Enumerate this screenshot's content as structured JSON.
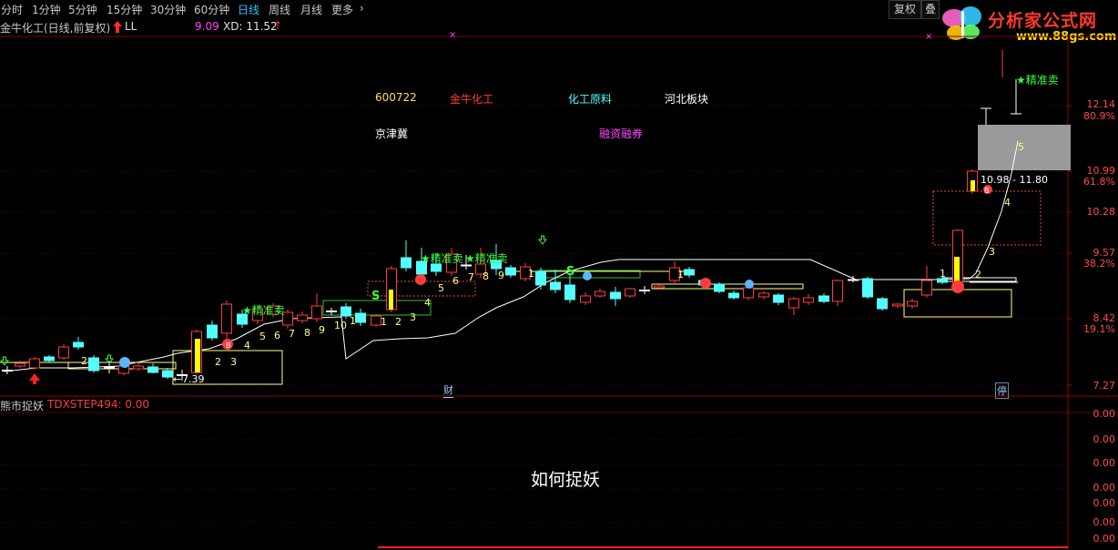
{
  "toolbar": {
    "periods": [
      "分时",
      "1分钟",
      "5分钟",
      "15分钟",
      "30分钟",
      "60分钟",
      "日线",
      "周线",
      "月线",
      "更多"
    ],
    "active_period": "日线",
    "more_arrow": "›",
    "restore_label": "复权",
    "stack_label": "叠"
  },
  "logo": {
    "brand": "分析家公式网",
    "site": "www.88gs.com"
  },
  "info": {
    "stock_title": "金牛化工(日线,前复权)",
    "ll_label": "LL",
    "ll_value": "9.09",
    "xd_label": "XD: 11.52",
    "up_arrow": "↑"
  },
  "stock_info": {
    "code": "600722",
    "name": "金牛化工",
    "industry": "化工原料",
    "sector": "河北板块",
    "region": "京津冀",
    "margin": "融资融券"
  },
  "price_axis": [
    "12.14",
    "80.9%",
    "10.99",
    "61.8%",
    "10.28",
    "9.57",
    "38.2%",
    "8.42",
    "19.1%",
    "7.27"
  ],
  "annotations": {
    "sell_signal": "★精准卖",
    "range_text": "10.98 - 11.80",
    "low_price": "7.39",
    "finance_marker": "财",
    "halt_marker": "停",
    "s_marker": "S",
    "top_marker": "5"
  },
  "indicator": {
    "name": "熊市捉妖",
    "param": "TDXSTEP494: 0.00",
    "title": "如何捉妖",
    "axis": [
      "0.00",
      "0.00",
      "0.00",
      "0.00",
      "0.00",
      "0.00",
      "0.00"
    ]
  },
  "colors": {
    "up": "#ff3c3c",
    "down": "#54ffff",
    "accent_active": "#2ac3ff",
    "signal_green": "#39ff39",
    "highlight_yellow": "#ffff00"
  }
}
